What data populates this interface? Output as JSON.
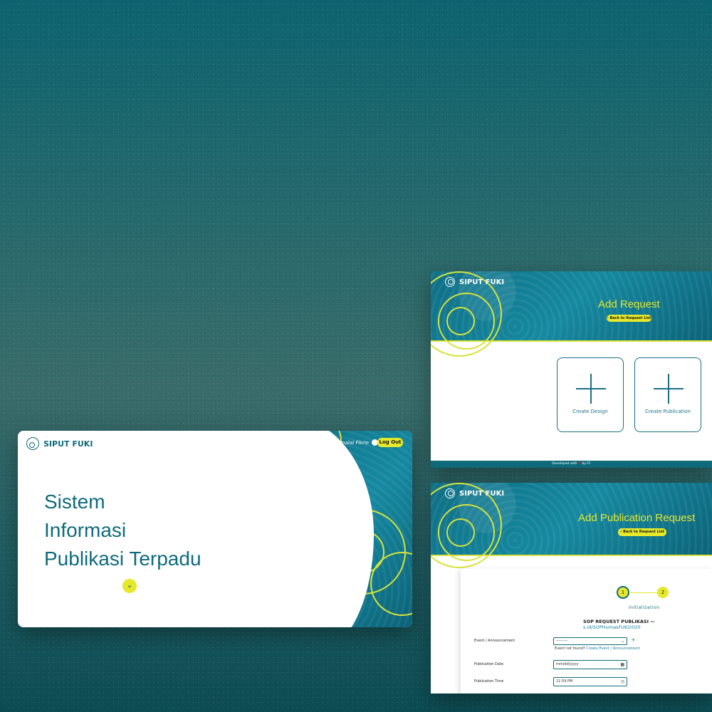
{
  "card1": {
    "app_name": "SIPUT FUKI",
    "hero_lines": [
      "Sistem",
      "Informasi",
      "Publikasi Terpadu"
    ],
    "user_name": "Fadlli Ajmalal Fikrie",
    "logout_label": "Log Out",
    "scroll_icon": "chevron-down-icon"
  },
  "card2": {
    "app_name": "SIPUT FUKI",
    "title": "Add Request",
    "back_label": "Back to Request List",
    "tiles": [
      {
        "label": "Create Design"
      },
      {
        "label": "Create Publication"
      }
    ],
    "footer_prefix": "Developed with",
    "footer_suffix": "by FF"
  },
  "card3": {
    "app_name": "SIPUT FUKI",
    "title": "Add Publication Request",
    "back_label": "Back to Request List",
    "steps": [
      "1",
      "2"
    ],
    "step_label": "Initialization",
    "sop_text": "SOP REQUEST PUBLIKASI —",
    "sop_link": "s.id/SOPHumasFUKI2020",
    "fields": {
      "event_label": "Event / Announcement",
      "event_value": "---------",
      "event_hint": "Event not found?",
      "event_hint_link": "Create Event / Announcement",
      "date_label": "Publication Date",
      "date_value": "mm/dd/yyyy",
      "time_label": "Publication Time",
      "time_value": "11:59 PM"
    }
  },
  "colors": {
    "teal": "#0f6b7c",
    "yellow": "#e7e82a",
    "lime_line": "#d9e33a"
  }
}
